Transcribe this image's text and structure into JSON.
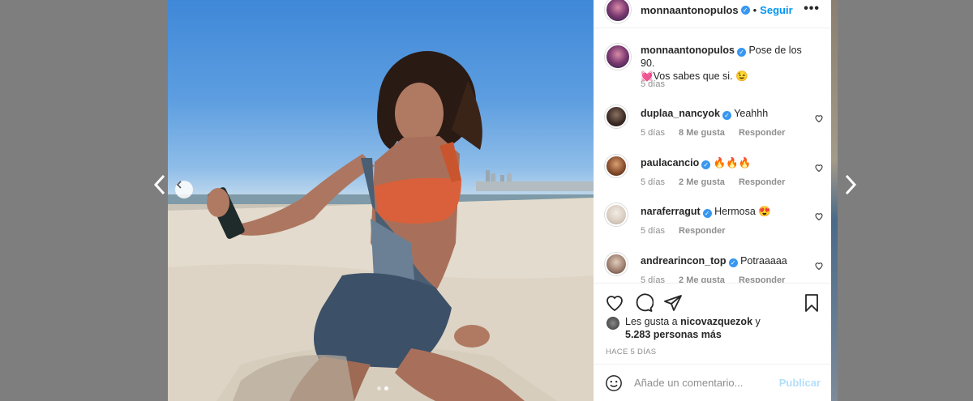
{
  "post": {
    "username": "monnaantonopulos",
    "follow_label": "Seguir",
    "more_label": "•••",
    "caption_user": "monnaantonopulos",
    "caption_line1": "Pose de los 90.",
    "caption_line2": "💓Vos sabes que si. 😉",
    "caption_time": "5 días"
  },
  "comments": [
    {
      "user": "duplaa_nancyok",
      "text": "Yeahhh",
      "time": "5 días",
      "likes": "8 Me gusta",
      "reply": "Responder"
    },
    {
      "user": "paulacancio",
      "text": "🔥🔥🔥",
      "time": "5 días",
      "likes": "2 Me gusta",
      "reply": "Responder"
    },
    {
      "user": "naraferragut",
      "text": "Hermosa 😍",
      "time": "5 días",
      "likes": "",
      "reply": "Responder"
    },
    {
      "user": "andrearincon_top",
      "text": "Potraaaaa",
      "time": "5 días",
      "likes": "2 Me gusta",
      "reply": "Responder"
    }
  ],
  "likes": {
    "line1_prefix": "Les gusta a ",
    "line1_user": "nicovazquezok",
    "line1_suffix": " y",
    "line2": "5.283 personas más"
  },
  "timeago": "HACE 5 DÍAS",
  "add_comment": {
    "placeholder": "Añade un comentario...",
    "publish": "Publicar"
  },
  "carousel": {
    "current": 1,
    "total": 2
  },
  "colors": {
    "accent": "#0095f6",
    "verified": "#3897f0",
    "publish_disabled": "#b2dffc"
  }
}
